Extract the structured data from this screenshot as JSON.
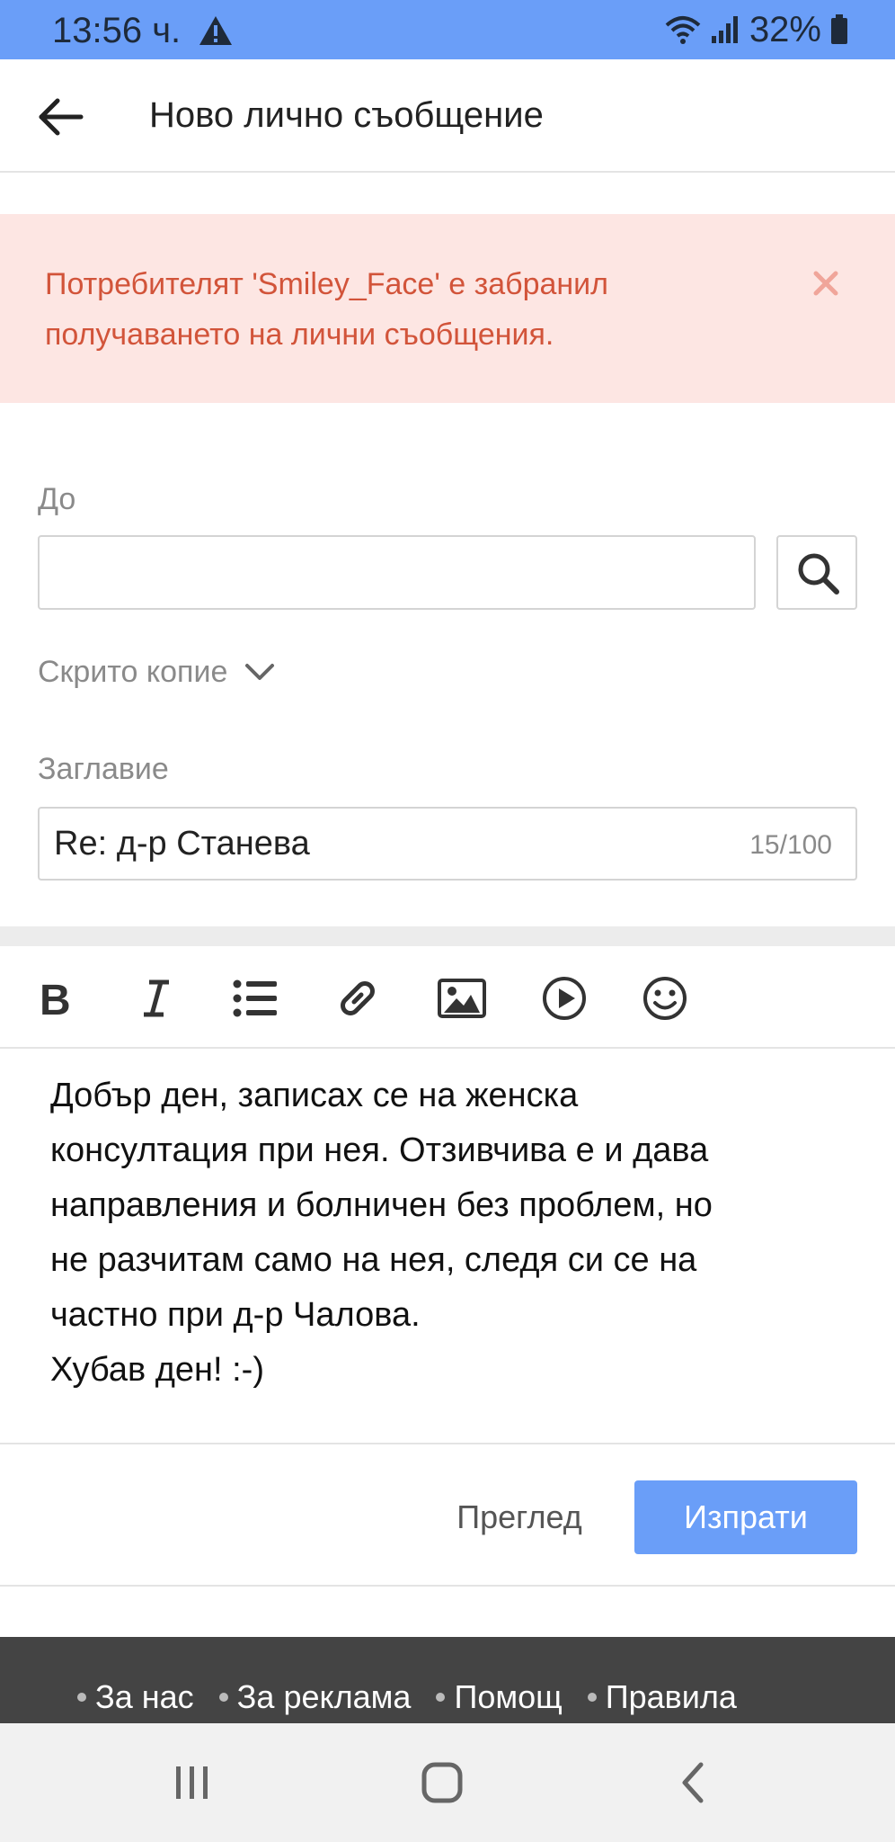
{
  "status_bar": {
    "time": "13:56 ч.",
    "battery": "32%",
    "icons": [
      "warning-icon",
      "wifi-icon",
      "signal-icon",
      "battery-icon"
    ]
  },
  "app_bar": {
    "title": "Ново лично съобщение",
    "back_icon": "arrow-left-icon"
  },
  "alert": {
    "message": "Потребителят 'Smiley_Face' е забранил получаването на лични съобщения.",
    "close_icon": "close-icon"
  },
  "form": {
    "to_label": "До",
    "to_value": "",
    "bcc_label": "Скрито копие",
    "subject_label": "Заглавие",
    "subject_value": "Re: д-р Станева",
    "subject_counter": "15/100"
  },
  "toolbar": {
    "icons": [
      "bold-icon",
      "italic-icon",
      "bullet-list-icon",
      "link-icon",
      "image-icon",
      "video-icon",
      "emoji-icon"
    ]
  },
  "editor": {
    "body": "Добър ден, записах се на женска\nконсултация при нея. Отзивчива е и дава\nнаправления и болничен без проблем, но\nне разчитам само на нея, следя си се на\nчастно при д-р Чалова.\nХубав ден! :-)"
  },
  "actions": {
    "preview_label": "Преглед",
    "send_label": "Изпрати"
  },
  "footer": {
    "links": [
      "За нас",
      "За реклама",
      "Помощ",
      "Правила"
    ]
  },
  "nav_bar": {
    "icons": [
      "recent-apps-icon",
      "home-icon",
      "back-icon"
    ]
  },
  "colors": {
    "accent": "#6a9ef8",
    "alert_bg": "#fde6e3",
    "alert_text": "#d2543a",
    "footer_bg": "#444444"
  }
}
